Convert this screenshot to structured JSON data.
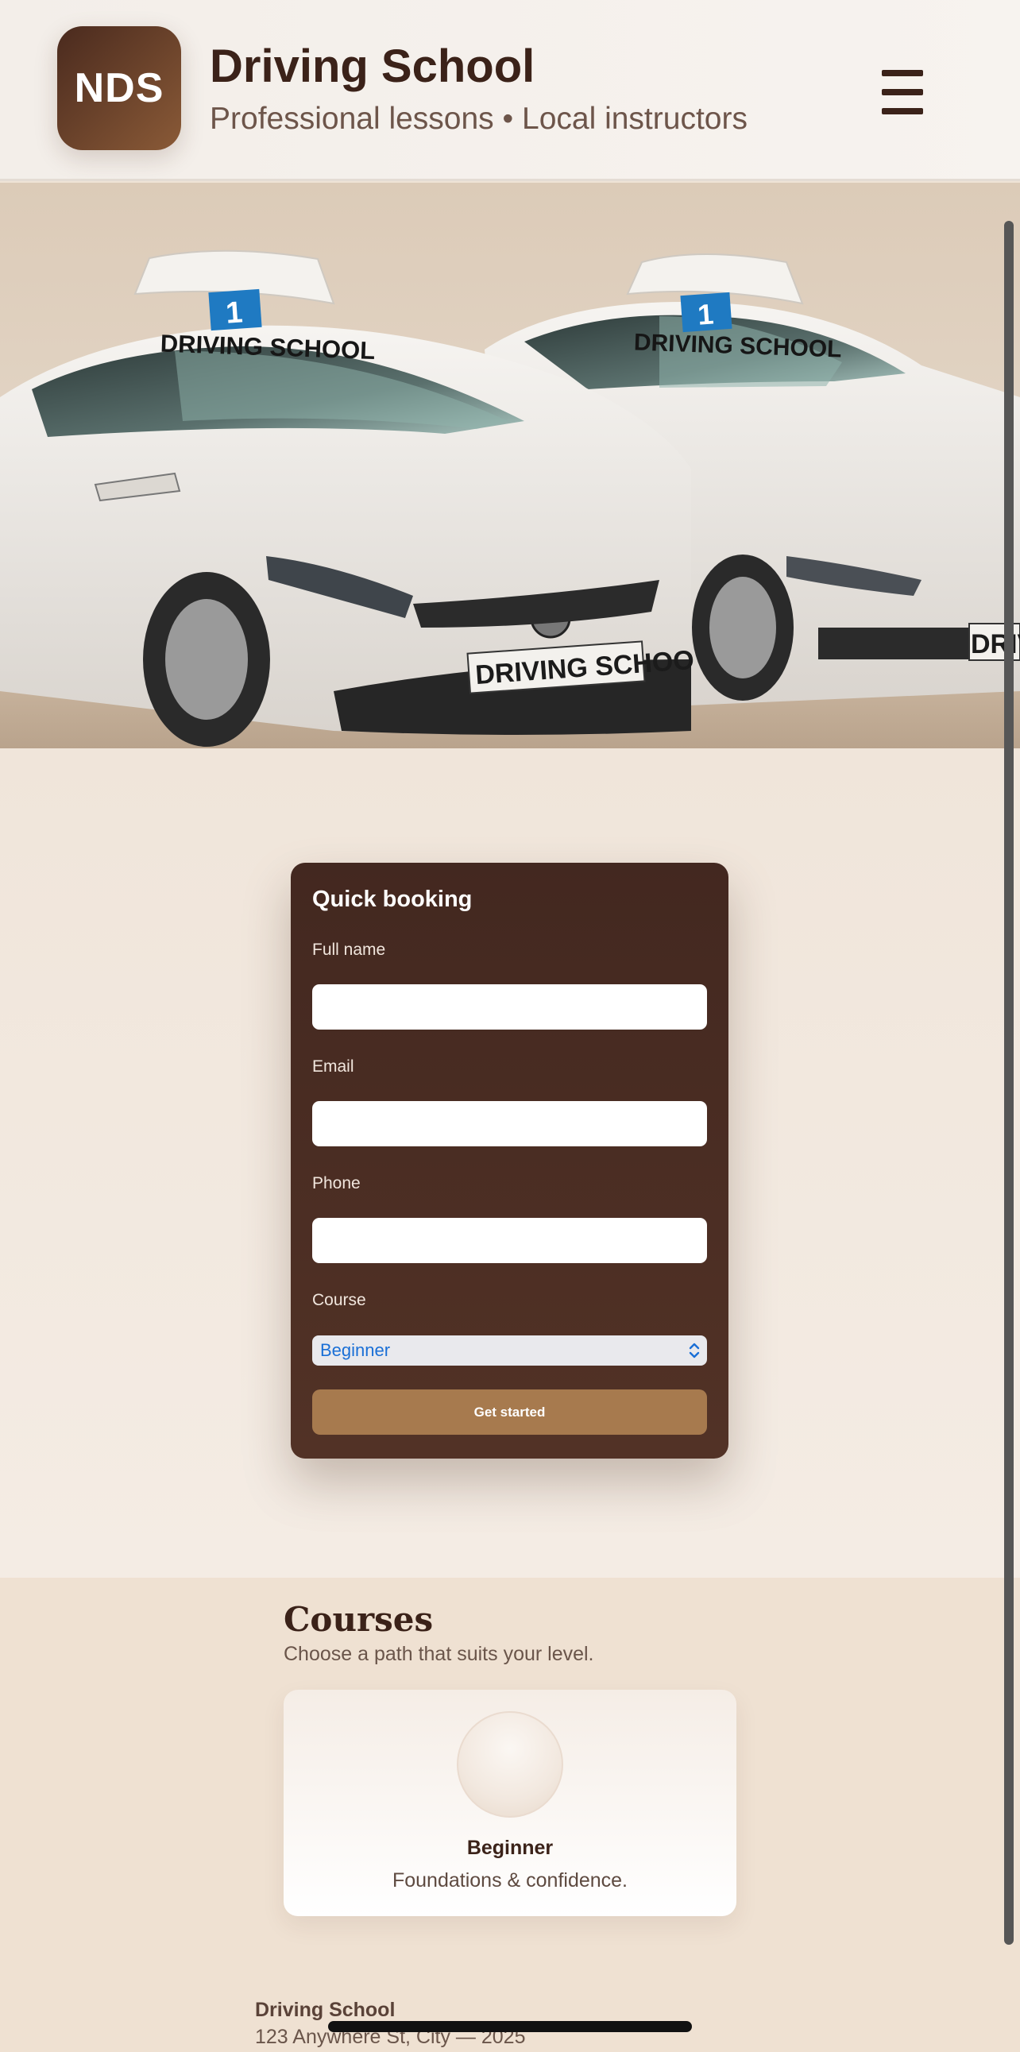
{
  "header": {
    "logo_text": "NDS",
    "title": "Driving School",
    "tagline": "Professional lessons • Local instructors",
    "menu_icon": "hamburger-menu-icon"
  },
  "hero": {
    "roof_sign_number": "1",
    "roof_sign_text": "DRIVING SCHOOL",
    "plate_text": "DRIVING SCHOO",
    "plate_text_partial": "DRIV"
  },
  "booking": {
    "title": "Quick booking",
    "fields": [
      {
        "label": "Full name",
        "value": "",
        "placeholder": ""
      },
      {
        "label": "Email",
        "value": "",
        "placeholder": ""
      },
      {
        "label": "Phone",
        "value": "",
        "placeholder": ""
      }
    ],
    "course_label": "Course",
    "course_selected": "Beginner",
    "submit_label": "Get started"
  },
  "courses": {
    "title": "Courses",
    "subtitle": "Choose a path that suits your level.",
    "items": [
      {
        "name": "Beginner",
        "description": "Foundations & confidence."
      }
    ]
  },
  "footer": {
    "name": "Driving School",
    "address": "123 Anywhere St, City — 2025"
  },
  "colors": {
    "brand_dark": "#3b2219",
    "card_bg": "#4a2c22",
    "accent": "#a77a4e",
    "page_bg": "#efe3d6"
  }
}
